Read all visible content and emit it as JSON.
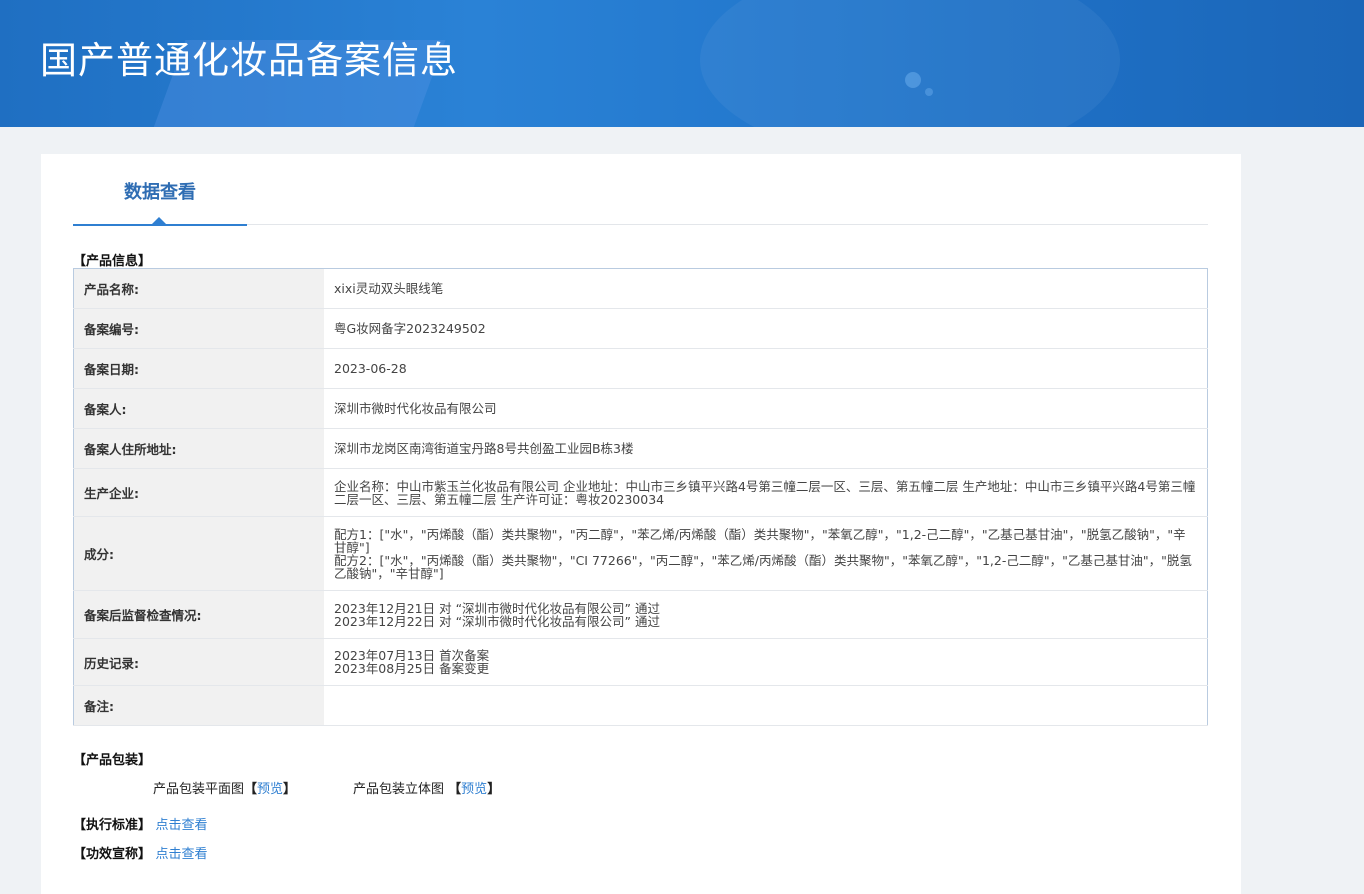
{
  "header": {
    "title": "国产普通化妆品备案信息"
  },
  "tabs": [
    {
      "label": "数据查看"
    }
  ],
  "product_section": {
    "label": "【产品信息】",
    "rows": [
      {
        "key": "产品名称:",
        "value": [
          "xixi灵动双头眼线笔"
        ]
      },
      {
        "key": "备案编号:",
        "value": [
          "粤G妆网备字2023249502"
        ]
      },
      {
        "key": "备案日期:",
        "value": [
          "2023-06-28"
        ]
      },
      {
        "key": "备案人:",
        "value": [
          "深圳市微时代化妆品有限公司"
        ]
      },
      {
        "key": "备案人住所地址:",
        "value": [
          "深圳市龙岗区南湾街道宝丹路8号共创盈工业园B栋3楼"
        ]
      },
      {
        "key": "生产企业:",
        "value": [
          "企业名称：中山市紫玉兰化妆品有限公司 企业地址：中山市三乡镇平兴路4号第三幢二层一区、三层、第五幢二层 生产地址：中山市三乡镇平兴路4号第三幢二层一区、三层、第五幢二层 生产许可证：粤妆20230034"
        ]
      },
      {
        "key": "成分:",
        "value": [
          "配方1：[\"水\"，\"丙烯酸（酯）类共聚物\"，\"丙二醇\"，\"苯乙烯/丙烯酸（酯）类共聚物\"，\"苯氧乙醇\"，\"1,2-己二醇\"，\"乙基己基甘油\"，\"脱氢乙酸钠\"，\"辛甘醇\"]",
          "配方2：[\"水\"，\"丙烯酸（酯）类共聚物\"，\"CI 77266\"，\"丙二醇\"，\"苯乙烯/丙烯酸（酯）类共聚物\"，\"苯氧乙醇\"，\"1,2-己二醇\"，\"乙基己基甘油\"，\"脱氢乙酸钠\"，\"辛甘醇\"]"
        ]
      },
      {
        "key": "备案后监督检查情况:",
        "value": [
          "2023年12月21日 对 “深圳市微时代化妆品有限公司” 通过",
          "2023年12月22日 对 “深圳市微时代化妆品有限公司” 通过"
        ]
      },
      {
        "key": "历史记录:",
        "value": [
          "2023年07月13日 首次备案",
          "2023年08月25日 备案变更"
        ]
      },
      {
        "key": "备注:",
        "value": [
          ""
        ]
      }
    ]
  },
  "package_section": {
    "label": "【产品包装】",
    "flat_label": "产品包装平面图",
    "solid_label": "产品包装立体图",
    "preview_link": "预览",
    "bracket_open": "【",
    "bracket_close": "】"
  },
  "standard_section": {
    "label": "【执行标准】",
    "link": "点击查看"
  },
  "efficacy_section": {
    "label": "【功效宣称】",
    "link": "点击查看"
  }
}
